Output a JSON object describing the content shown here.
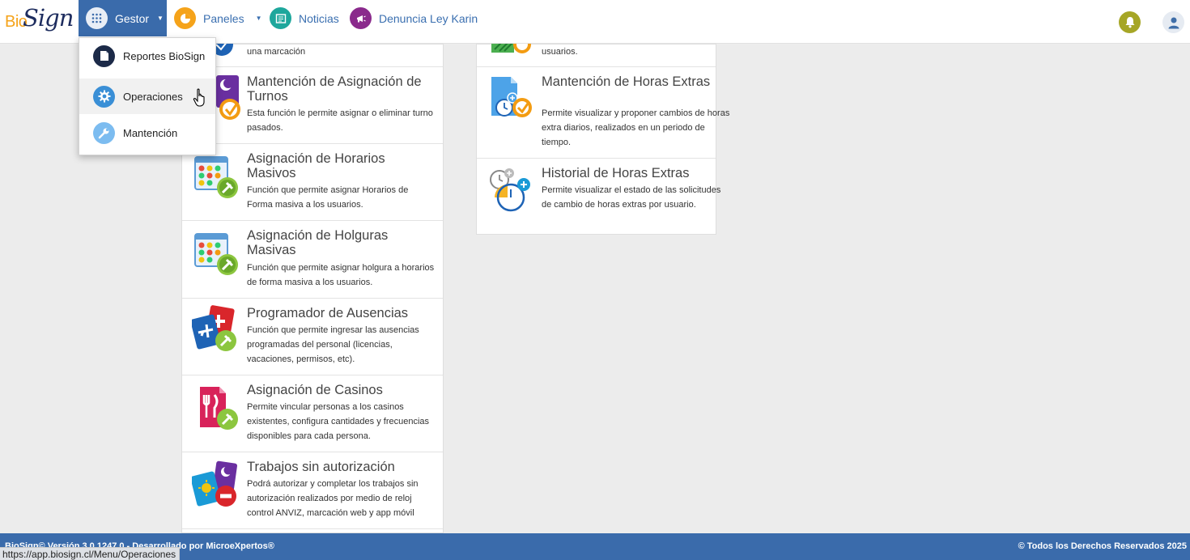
{
  "brand": {
    "logo_prefix": "Bio",
    "logo_suffix": "Sign"
  },
  "nav": {
    "gestor": "Gestor",
    "paneles": "Paneles",
    "noticias": "Noticias",
    "denuncia": "Denuncia Ley Karin"
  },
  "dropdown": {
    "items": [
      {
        "label": "Reportes BioSign",
        "icon": "document-icon"
      },
      {
        "label": "Operaciones",
        "icon": "gear-icon"
      },
      {
        "label": "Mantención",
        "icon": "wrench-icon"
      }
    ]
  },
  "left_cards": [
    {
      "title": "",
      "desc": "una marcación"
    },
    {
      "title": "Mantención de Asignación de Turnos",
      "desc": "Esta función le permite asignar o eliminar turno pasados."
    },
    {
      "title": "Asignación de Horarios Masivos",
      "desc": "Función que permite asignar Horarios de Forma masiva a los usuarios."
    },
    {
      "title": "Asignación de Holguras Masivas",
      "desc": "Función que permite asignar holgura a horarios de forma masiva a los usuarios."
    },
    {
      "title": "Programador de Ausencias",
      "desc": "Función que permite ingresar las ausencias programadas del personal (licencias, vacaciones, permisos, etc)."
    },
    {
      "title": "Asignación de Casinos",
      "desc": "Permite vincular personas a los casinos existentes, configura cantidades y frecuencias disponibles para cada persona."
    },
    {
      "title": "Trabajos sin autorización",
      "desc": "Podrá autorizar y completar los trabajos sin autorización realizados por medio de reloj control ANVIZ, marcación web y app móvil"
    }
  ],
  "right_cards": [
    {
      "title": "",
      "desc": "usuarios."
    },
    {
      "title": "Mantención de Horas Extras",
      "desc": "Permite visualizar y proponer cambios de horas extra diarios, realizados en un periodo de tiempo."
    },
    {
      "title": "Historial de Horas Extras",
      "desc": "Permite visualizar el estado de las solicitudes de cambio de horas extras por usuario."
    }
  ],
  "footer": {
    "left": "BioSign© Versión 3.0.1247.0 - Desarrollado por MicroeXpertos®",
    "right": "© Todos los Derechos Reservados 2025"
  },
  "status_url": "https://app.biosign.cl/Menu/Operaciones",
  "colors": {
    "primary": "#3a6bab",
    "orange": "#f5a31a",
    "teal": "#1ea79c",
    "purple": "#8a2a8c",
    "olive": "#a6a626"
  }
}
